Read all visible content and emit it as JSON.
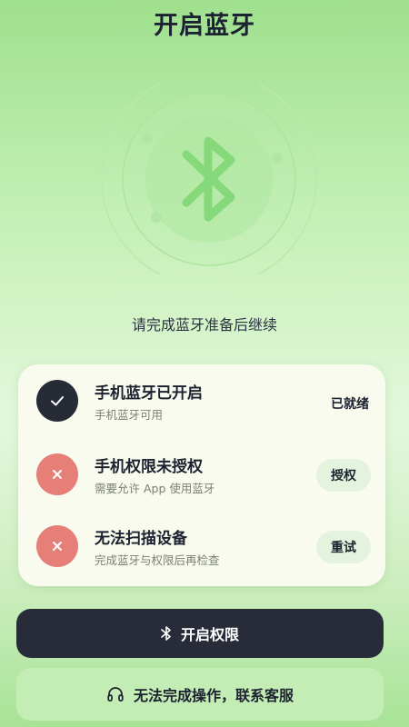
{
  "header": {
    "title": "开启蓝牙"
  },
  "illustration": {
    "icon": "bluetooth-icon",
    "accent_color": "#86d97a"
  },
  "subtitle": "请完成蓝牙准备后继续",
  "checklist": [
    {
      "title": "手机蓝牙已开启",
      "description": "手机蓝牙可用",
      "status": "ok",
      "status_icon": "check-icon",
      "action_text": "已就绪"
    },
    {
      "title": "手机权限未授权",
      "description": "需要允许 App 使用蓝牙",
      "status": "error",
      "status_icon": "close-icon",
      "action_text": "授权"
    },
    {
      "title": "无法扫描设备",
      "description": "完成蓝牙与权限后再检查",
      "status": "error",
      "status_icon": "close-icon",
      "action_text": "重试"
    }
  ],
  "primary_button": {
    "label": "开启权限",
    "icon": "bluetooth-icon"
  },
  "secondary_button": {
    "label": "无法完成操作，联系客服",
    "icon": "headphones-icon"
  },
  "colors": {
    "dark": "#272c38",
    "error": "#e57f78",
    "card": "#f8fbee",
    "pill": "#e4f3dd"
  }
}
